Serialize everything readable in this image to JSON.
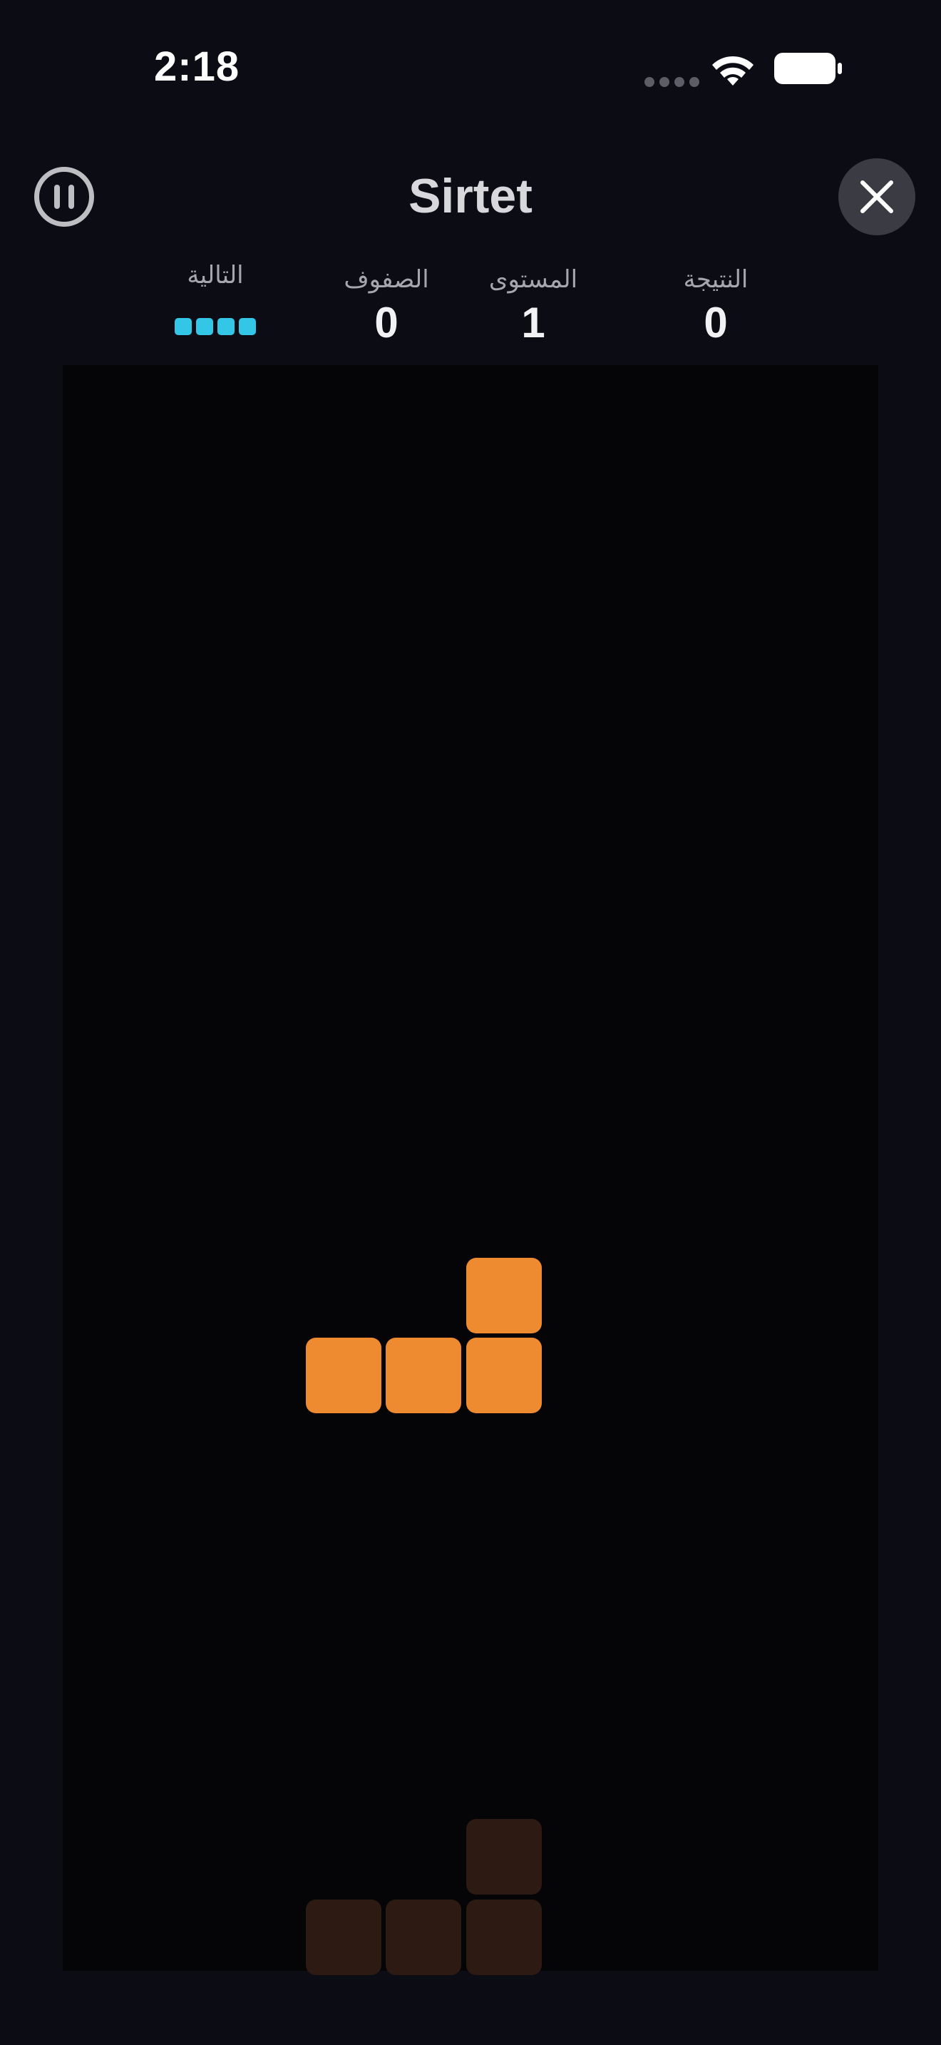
{
  "status_bar": {
    "time": "2:18"
  },
  "header": {
    "title": "Sirtet",
    "pause_icon": "pause-circle-icon",
    "close_icon": "xmark-icon"
  },
  "stats": {
    "score_label": "النتيجة",
    "score_value": "0",
    "level_label": "المستوى",
    "level_value": "1",
    "lines_label": "الصفوف",
    "lines_value": "0",
    "next_label": "التالية",
    "next_piece": "I",
    "next_piece_color": "#33c6e6"
  },
  "board": {
    "columns": 10,
    "active_piece": {
      "type": "L",
      "color": "#ee8a2f",
      "cells": [
        [
          5,
          11
        ],
        [
          3,
          12
        ],
        [
          4,
          12
        ],
        [
          5,
          12
        ]
      ]
    },
    "ghost_piece": {
      "color": "#2c1a13",
      "cells": [
        [
          5,
          18
        ],
        [
          3,
          19
        ],
        [
          4,
          19
        ],
        [
          5,
          19
        ]
      ]
    }
  },
  "colors": {
    "background": "#0b0c14",
    "board_background": "#050508",
    "close_button_bg": "#3a3b43"
  }
}
